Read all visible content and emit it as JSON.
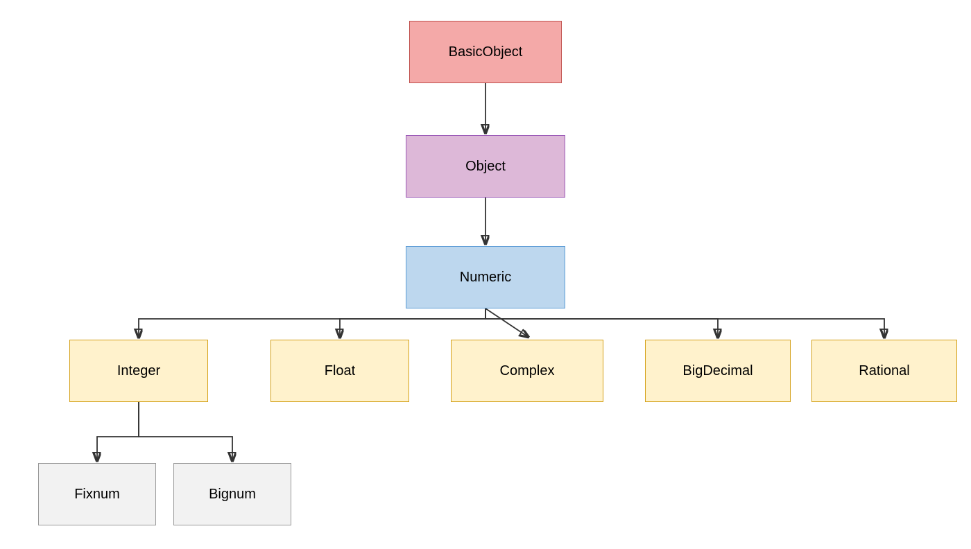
{
  "nodes": {
    "basicObject": {
      "label": "BasicObject"
    },
    "object": {
      "label": "Object"
    },
    "numeric": {
      "label": "Numeric"
    },
    "integer": {
      "label": "Integer"
    },
    "float": {
      "label": "Float"
    },
    "complex": {
      "label": "Complex"
    },
    "bigDecimal": {
      "label": "BigDecimal"
    },
    "rational": {
      "label": "Rational"
    },
    "fixnum": {
      "label": "Fixnum"
    },
    "bignum": {
      "label": "Bignum"
    }
  }
}
